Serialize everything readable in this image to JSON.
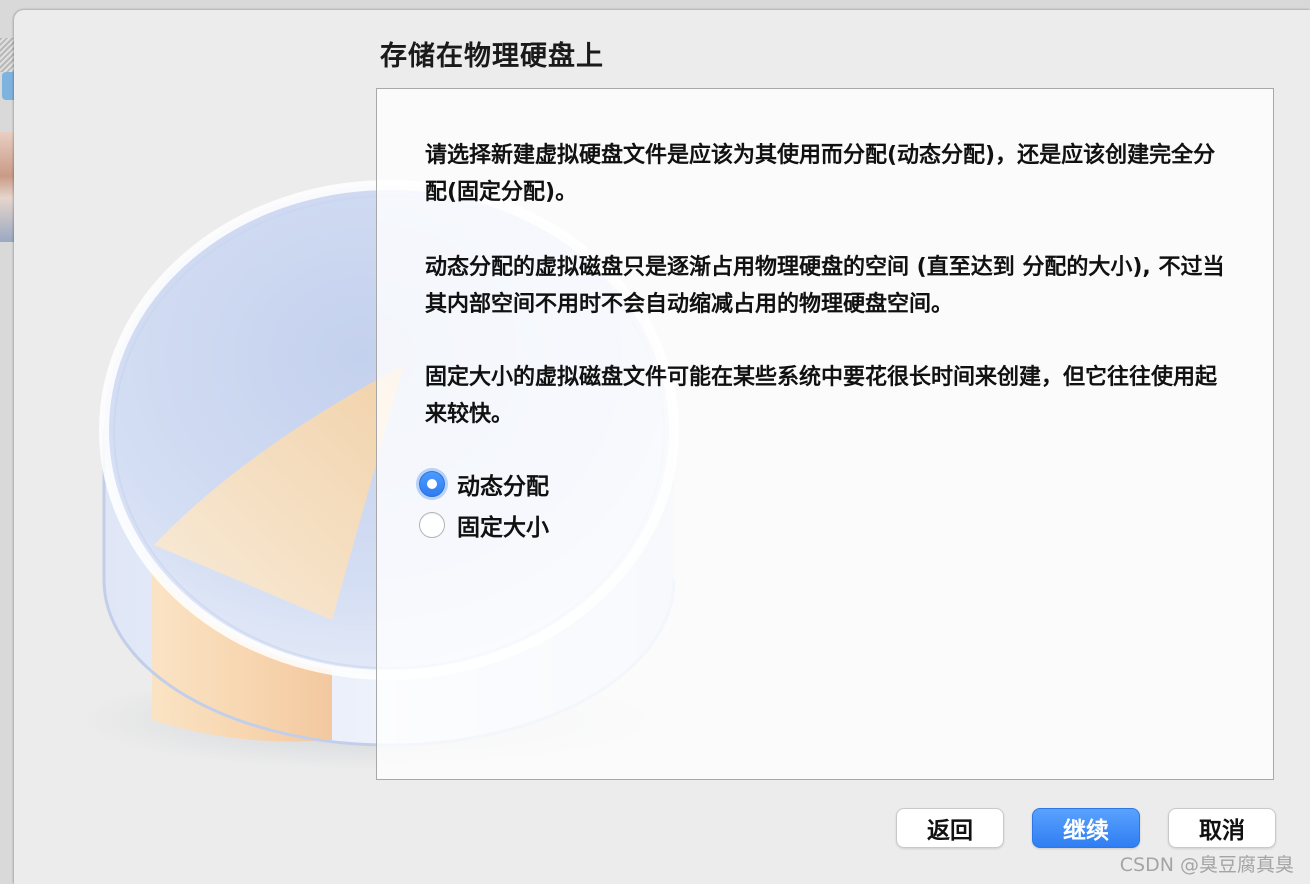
{
  "dialog": {
    "title": "存储在物理硬盘上",
    "paragraphs": [
      "请选择新建虚拟硬盘文件是应该为其使用而分配(动态分配)，还是应该创建完全分配(固定分配)。",
      "动态分配的虚拟磁盘只是逐渐占用物理硬盘的空间 (直至达到 分配的大小), 不过当其内部空间不用时不会自动缩减占用的物理硬盘空间。",
      "固定大小的虚拟磁盘文件可能在某些系统中要花很长时间来创建，但它往往使用起来较快。"
    ],
    "options": [
      {
        "label": "动态分配",
        "selected": true
      },
      {
        "label": "固定大小",
        "selected": false
      }
    ]
  },
  "buttons": {
    "back": "返回",
    "continue": "继续",
    "cancel": "取消"
  },
  "watermark": "CSDN @臭豆腐真臭",
  "colors": {
    "accent": "#2f7ef2",
    "dialog_bg": "#ececec",
    "panel_bg": "#ffffff",
    "disk_orange": "#f5c99a",
    "disk_blue": "#c8d6f0"
  },
  "icons": {
    "disk_illustration": "pie-disk-illustration"
  }
}
